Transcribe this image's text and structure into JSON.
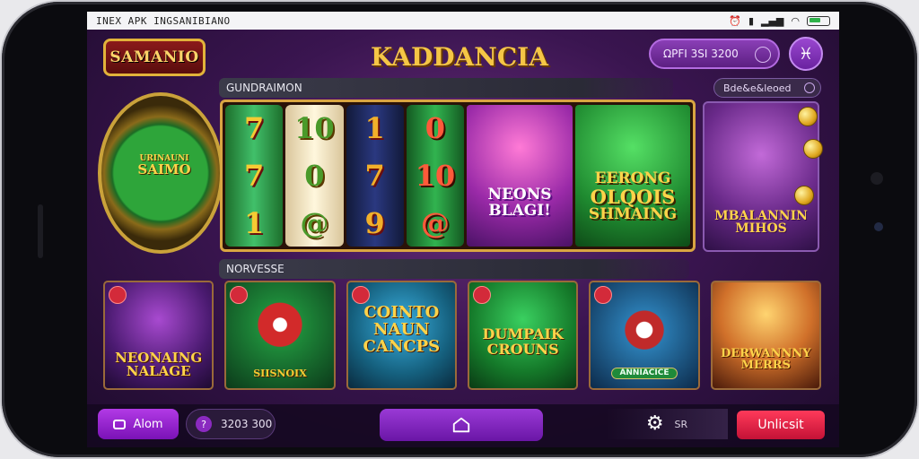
{
  "status_bar": {
    "title": "INEX APK INGSANIBIANO"
  },
  "header": {
    "logo_text": "SAMANIO",
    "app_title": "KADDANCIA",
    "search_value": "ΩPFI 3SI 3200",
    "menu_icon": "pisces-icon"
  },
  "featured": {
    "section_title": "GUNDRAIMON",
    "filter_chip": "Bde&e&leoed",
    "wheel_top": "URINAUNI",
    "wheel_label": "SAIMO",
    "reel_columns": [
      [
        "7",
        "7",
        "1"
      ],
      [
        "10",
        "0",
        "@"
      ],
      [
        "1",
        "7",
        "9"
      ],
      [
        "0",
        "10",
        "@"
      ]
    ],
    "banner_left": "NEONS BLAGI!",
    "banner_right_line1": "EERONG",
    "banner_right_line2": "OLQOIS",
    "banner_right_line3": "SHMAING",
    "side_card": "MBALANNIN MIHOS"
  },
  "games": {
    "section_title": "NORVESSE",
    "tiles": [
      {
        "title": "NEONAING NALAGE",
        "theme": "purple"
      },
      {
        "title": "SIISNOIX",
        "theme": "red-ball"
      },
      {
        "title": "COINTO NAUN CANCPS",
        "theme": "blue"
      },
      {
        "title": "DUMPAIK CROUNS",
        "theme": "green"
      },
      {
        "title": "ANNIACICE",
        "theme": "roulette"
      },
      {
        "title": "DERWANNNY MERRS",
        "theme": "orange"
      }
    ]
  },
  "bottom_bar": {
    "alarm_label": "Alom",
    "balance_icon": "?",
    "balance_value": "3203 300",
    "home_icon": "home-icon",
    "gear_suffix": "SR",
    "unlock_label": "Unlicsit"
  },
  "colors": {
    "accent": "#9a3ad6",
    "gold": "#f5c646",
    "danger": "#e0203f"
  }
}
